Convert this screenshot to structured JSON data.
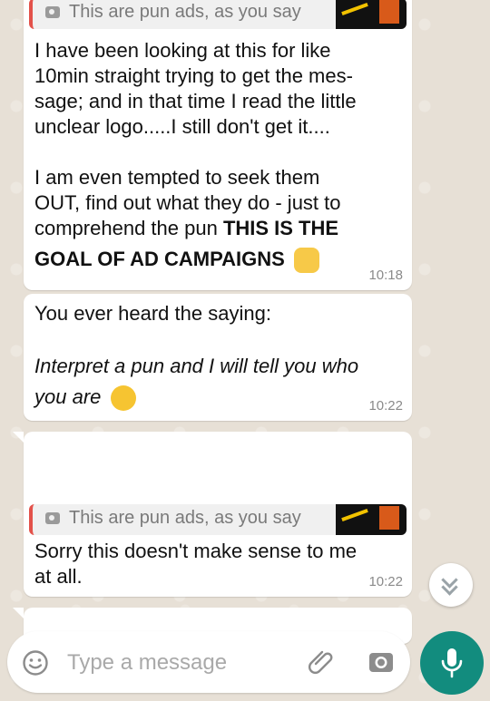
{
  "messages": [
    {
      "quote": {
        "text": "This are pun ads, as you say",
        "icon": "camera-icon"
      },
      "lines": [
        "I have been looking at this for like",
        "10min straight trying to get the mes-",
        "sage;  and in that time  I read the little",
        "unclear logo.....I still don't get it....",
        "",
        "I am even tempted to seek them",
        "OUT, find out what they do  - just to"
      ],
      "line8_normal": "comprehend the pun ",
      "line8_bold": "THIS IS THE",
      "line9_bold": "GOAL OF AD CAMPAIGNS",
      "emoji": "victory-hand",
      "time": "10:18"
    },
    {
      "line1": "You ever heard the saying:",
      "italic1": "Interpret a pun and I will tell you who",
      "italic2": "you are",
      "emoji": "rolling-on-floor-laughing",
      "time": "10:22"
    },
    {
      "quote": {
        "text": "This are pun ads, as you say",
        "icon": "camera-icon"
      },
      "line1": "Sorry this doesn't make sense to me",
      "line2": "at all.",
      "time": "10:22"
    }
  ],
  "composer": {
    "placeholder": "Type a message",
    "emoji_icon": "smiley-icon",
    "attach_icon": "paperclip-icon",
    "camera_icon": "camera-icon",
    "mic_icon": "mic-icon"
  },
  "colors": {
    "accent": "#128c7e",
    "quote_bar": "#e3514a",
    "bubble": "#ffffff"
  }
}
